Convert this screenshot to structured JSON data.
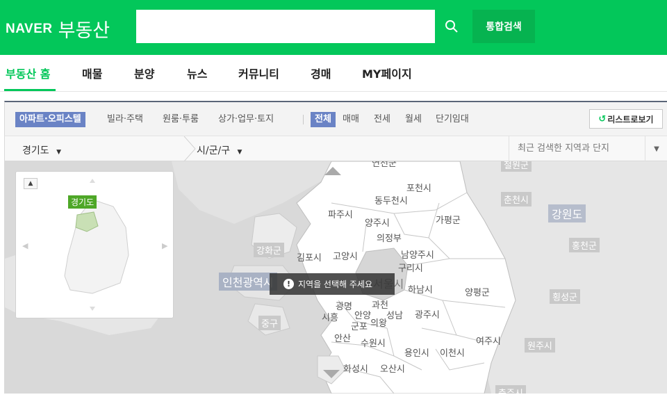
{
  "header": {
    "brand": "NAVER",
    "service": "부동산",
    "search_placeholder": "",
    "total_search": "통합검색"
  },
  "nav": {
    "items": [
      "부동산 홈",
      "매물",
      "분양",
      "뉴스",
      "커뮤니티",
      "경매",
      "MY페이지"
    ],
    "active": "부동산 홈"
  },
  "filters": {
    "property_types": [
      "아파트·오피스텔",
      "빌라·주택",
      "원룸·투룸",
      "상가·업무·토지"
    ],
    "trade_types": [
      "전체",
      "매매",
      "전세",
      "월세",
      "단기임대"
    ],
    "list_view": "리스트로보기"
  },
  "region": {
    "province": "경기도",
    "district": "시/군/구",
    "recent": "최근 검색한 지역과 단지"
  },
  "minimap": {
    "selected": "경기도"
  },
  "map": {
    "message": "지역을 선택해 주세요",
    "labels": {
      "north_top": "연천군",
      "cheorwon": "철원군",
      "pocheon": "포천시",
      "dongducheon": "동두천시",
      "paju": "파주시",
      "yangju": "양주시",
      "gapyeong": "가평군",
      "chuncheon": "춘천시",
      "gangwon": "강원도",
      "uijeongbu": "의정부",
      "ganghwa": "강화군",
      "gimpo": "김포시",
      "goyang": "고양시",
      "namyangju": "남양주시",
      "guri": "구리시",
      "hongcheon": "홍천군",
      "incheon": "인천광역시",
      "seoul": "서울시",
      "hanam": "하남시",
      "yangpyeong": "양평군",
      "hoengseong": "횡성군",
      "gwangmyeong": "광명",
      "gwacheon": "과천",
      "siheung": "시흥",
      "anyang": "안양",
      "seongnam": "성남",
      "gwangju": "광주시",
      "gunpo": "군포",
      "uiwang": "의왕",
      "junggu": "중구",
      "ansan": "안산",
      "suwon": "수원시",
      "yeoju": "여주시",
      "wonju": "원주시",
      "yongin": "용인시",
      "icheon": "이천시",
      "hwaseong": "화성시",
      "osan": "오산시",
      "chungju": "충주시"
    }
  },
  "colors": {
    "brand_green": "#03c75a",
    "chip_blue": "#6a83c5"
  }
}
